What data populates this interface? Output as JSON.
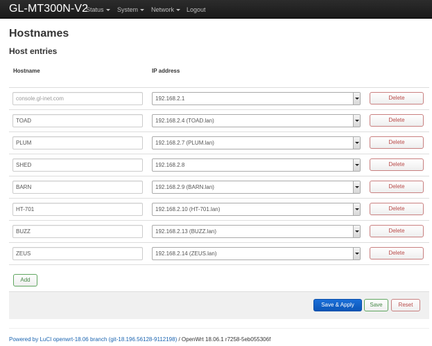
{
  "navbar": {
    "brand": "GL-MT300N-V2",
    "menu": [
      {
        "label": "Status",
        "dropdown": true
      },
      {
        "label": "System",
        "dropdown": true
      },
      {
        "label": "Network",
        "dropdown": true
      },
      {
        "label": "Logout",
        "dropdown": false
      }
    ]
  },
  "page": {
    "title": "Hostnames",
    "section_title": "Host entries",
    "columns": {
      "hostname": "Hostname",
      "ip_address": "IP address"
    }
  },
  "hosts": [
    {
      "hostname": "",
      "hostname_placeholder": "console.gl-inet.com",
      "ip": "192.168.2.1",
      "delete_label": "Delete"
    },
    {
      "hostname": "TOAD",
      "hostname_placeholder": "",
      "ip": "192.168.2.4 (TOAD.lan)",
      "delete_label": "Delete"
    },
    {
      "hostname": "PLUM",
      "hostname_placeholder": "",
      "ip": "192.168.2.7 (PLUM.lan)",
      "delete_label": "Delete"
    },
    {
      "hostname": "SHED",
      "hostname_placeholder": "",
      "ip": "192.168.2.8",
      "delete_label": "Delete"
    },
    {
      "hostname": "BARN",
      "hostname_placeholder": "",
      "ip": "192.168.2.9 (BARN.lan)",
      "delete_label": "Delete"
    },
    {
      "hostname": "HT-701",
      "hostname_placeholder": "",
      "ip": "192.168.2.10 (HT-701.lan)",
      "delete_label": "Delete"
    },
    {
      "hostname": "BUZZ",
      "hostname_placeholder": "",
      "ip": "192.168.2.13 (BUZZ.lan)",
      "delete_label": "Delete"
    },
    {
      "hostname": "ZEUS",
      "hostname_placeholder": "",
      "ip": "192.168.2.14 (ZEUS.lan)",
      "delete_label": "Delete"
    }
  ],
  "actions": {
    "add_label": "Add",
    "save_apply_label": "Save & Apply",
    "save_label": "Save",
    "reset_label": "Reset"
  },
  "footer": {
    "luci_link": "Powered by LuCI openwrt-18.06 branch (git-18.196.56128-9112198)",
    "separator": " / ",
    "version": "OpenWrt 18.06.1 r7258-5eb055306f"
  },
  "colors": {
    "navbar": "#1f1f1f",
    "primary": "#0b62c9",
    "success": "#468847",
    "danger": "#b94a48",
    "link": "#1a64b0"
  }
}
